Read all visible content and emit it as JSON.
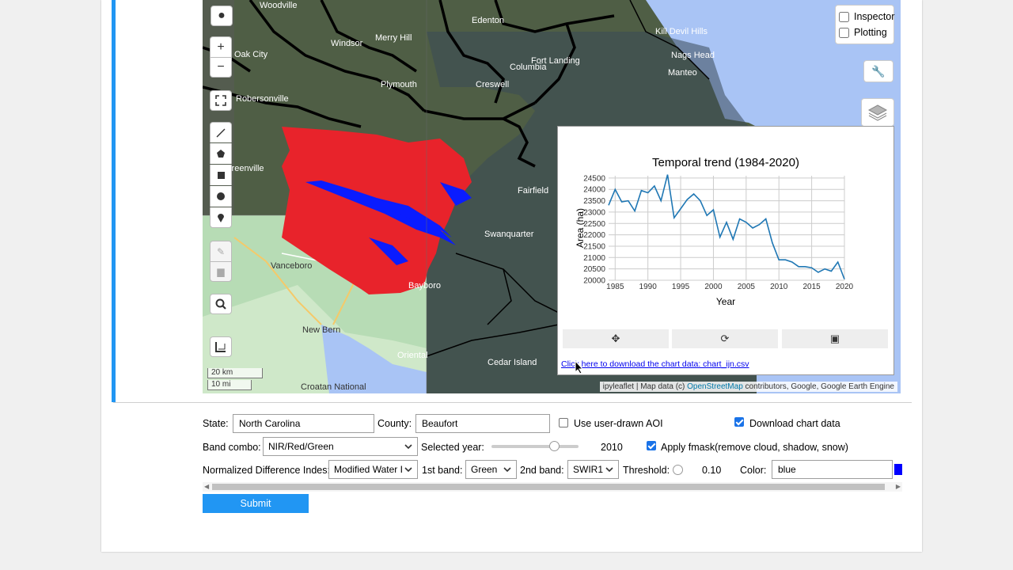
{
  "map": {
    "credit_text": "ipyleaflet | Map data (c) ",
    "credit_link": "OpenStreetMap",
    "credit_tail": " contributors, Google, Google Earth Engine",
    "place_labels": [
      "Edenton",
      "Merry Hill",
      "Windsor",
      "Oak City",
      "Robersonville",
      "Plymouth",
      "Columbia",
      "Creswell",
      "Fort Landing",
      "Manteo",
      "Nags Head",
      "Kill Devil Hills",
      "Fairfield",
      "Swanquarter",
      "Vanceboro",
      "New Bern",
      "Bayboro",
      "Oriental",
      "Cedar Island",
      "Croatan National",
      "Greenville",
      "Woodville"
    ],
    "scale_km": "20 km",
    "scale_mi": "10 mi",
    "layers": [
      {
        "label": "Inspector",
        "checked": false
      },
      {
        "label": "Plotting",
        "checked": false
      }
    ],
    "colors": {
      "water": "#a9c4f5",
      "trend": "#1f77b4",
      "change": "#e8232b",
      "highlight": "#0a1cff"
    }
  },
  "chart": {
    "download_link": "Click here to download the chart data: chart_ijn.csv",
    "buttons": [
      "pan-icon",
      "refresh-icon",
      "save-icon"
    ]
  },
  "chart_data": {
    "type": "line",
    "title": "Temporal trend (1984-2020)",
    "xlabel": "Year",
    "ylabel": "Area (ha)",
    "xlim": [
      1984,
      2020
    ],
    "ylim": [
      20000,
      24600
    ],
    "xticks": [
      "1985",
      "1990",
      "1995",
      "2000",
      "2005",
      "2010",
      "2015",
      "2020"
    ],
    "yticks": [
      "24500",
      "24000",
      "23500",
      "23000",
      "22500",
      "22000",
      "21500",
      "21000",
      "20500",
      "20000"
    ],
    "grid": true,
    "series": [
      {
        "x": [
          1984,
          1985,
          1986,
          1987,
          1988,
          1989,
          1990,
          1991,
          1992,
          1993,
          1994,
          1995,
          1996,
          1997,
          1998,
          1999,
          2000,
          2001,
          2002,
          2003,
          2004,
          2005,
          2006,
          2007,
          2008,
          2009,
          2010,
          2011,
          2012,
          2013,
          2014,
          2015,
          2016,
          2017,
          2018,
          2019,
          2020
        ],
        "y": [
          23300,
          24000,
          23450,
          23500,
          23050,
          23950,
          23850,
          24150,
          23500,
          24650,
          22750,
          23150,
          23550,
          23800,
          23500,
          22850,
          23100,
          21900,
          22550,
          21800,
          22700,
          22550,
          22300,
          22450,
          22700,
          21650,
          20900,
          20900,
          20800,
          20600,
          20600,
          20550,
          20350,
          20500,
          20400,
          20800,
          20050
        ]
      }
    ]
  },
  "form": {
    "state_label": "State:",
    "state_value": "North Carolina",
    "county_label": "County:",
    "county_value": "Beaufort",
    "aoi_label": "Use user-drawn AOI",
    "aoi_checked": false,
    "download_label": "Download chart data",
    "download_checked": true,
    "band_label": "Band combo:",
    "band_value": "NIR/Red/Green",
    "year_label": "Selected year:",
    "year_value": "2010",
    "year_range": [
      1984,
      2020
    ],
    "fmask_label": "Apply fmask(remove cloud, shadow, snow)",
    "fmask_checked": true,
    "ndi_label": "Normalized Difference Indes:",
    "ndi_value": "Modified Water I",
    "band1_label": "1st band:",
    "band1_value": "Green",
    "band2_label": "2nd band:",
    "band2_value": "SWIR1",
    "threshold_label": "Threshold:",
    "threshold_value": "0.10",
    "color_label": "Color:",
    "color_value": "blue",
    "color_swatch": "#0000ff",
    "submit_label": "Submit"
  }
}
